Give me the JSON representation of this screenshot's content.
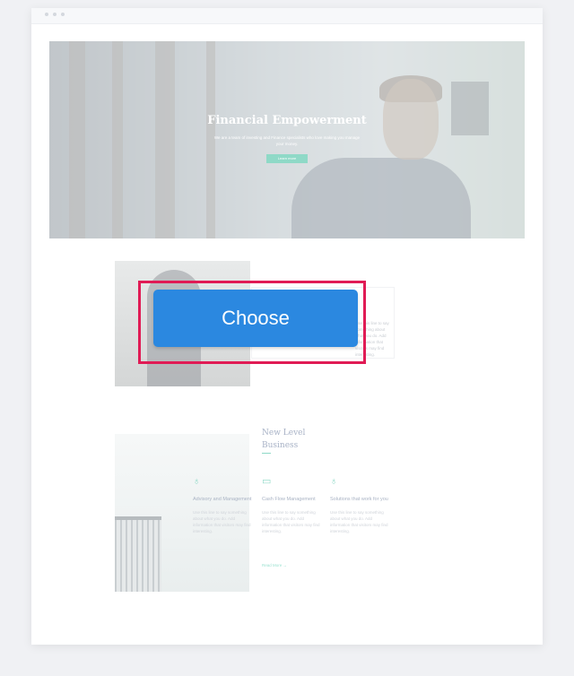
{
  "hero": {
    "title": "Financial Empowerment",
    "subtitle": "We are a team of investing and Finance specialists who love making you manage your money.",
    "button_label": "Learn more"
  },
  "about": {
    "snippet": "Use this line to say something about what you do. Add information that visitors may find interesting."
  },
  "overlay": {
    "choose_label": "Choose"
  },
  "business": {
    "title": "New Level Business",
    "services": [
      {
        "icon": "lightbulb-icon",
        "glyph": "♁",
        "title": "Advisory and Management",
        "desc": "Use this line to say something about what you do. Add information that visitors may find interesting."
      },
      {
        "icon": "monitor-icon",
        "glyph": "▭",
        "title": "Cash Flow Management",
        "desc": "Use this line to say something about what you do. Add information that visitors may find interesting."
      },
      {
        "icon": "moneybag-icon",
        "glyph": "♁",
        "title": "Solutions that work for you",
        "desc": "Use this line to say something about what you do. Add information that visitors may find interesting."
      }
    ],
    "read_more": "Read More →"
  },
  "colors": {
    "accent": "#8fd9c7",
    "choose_button": "#2b88e0",
    "highlight": "#e01b55"
  }
}
